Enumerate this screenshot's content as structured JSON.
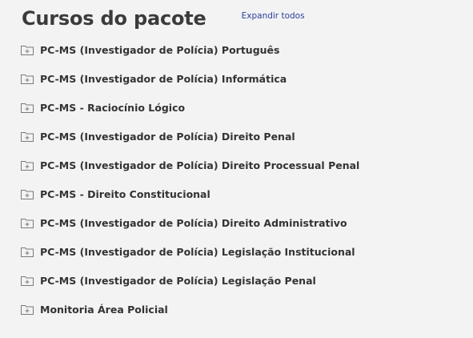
{
  "header": {
    "title": "Cursos do pacote",
    "expand_all": "Expandir todos"
  },
  "courses": [
    {
      "label": "PC-MS (Investigador de Polícia) Português",
      "icon": "folder-plus-icon"
    },
    {
      "label": "PC-MS (Investigador de Polícia) Informática",
      "icon": "folder-plus-icon"
    },
    {
      "label": "PC-MS - Raciocínio Lógico",
      "icon": "folder-plus-icon"
    },
    {
      "label": "PC-MS (Investigador de Polícia) Direito Penal",
      "icon": "folder-plus-icon"
    },
    {
      "label": "PC-MS (Investigador de Polícia) Direito Processual Penal",
      "icon": "folder-plus-icon"
    },
    {
      "label": "PC-MS - Direito Constitucional",
      "icon": "folder-plus-icon"
    },
    {
      "label": "PC-MS (Investigador de Polícia) Direito Administrativo",
      "icon": "folder-plus-icon"
    },
    {
      "label": "PC-MS (Investigador de Polícia) Legislação Institucional",
      "icon": "folder-plus-icon"
    },
    {
      "label": "PC-MS (Investigador de Polícia) Legislação Penal",
      "icon": "folder-plus-icon"
    },
    {
      "label": "Monitoria Área Policial",
      "icon": "folder-plus-icon"
    }
  ],
  "colors": {
    "background": "#f3f3f3",
    "text": "#333333",
    "link": "#2c3e9e",
    "icon_stroke": "#7a7a7a"
  }
}
